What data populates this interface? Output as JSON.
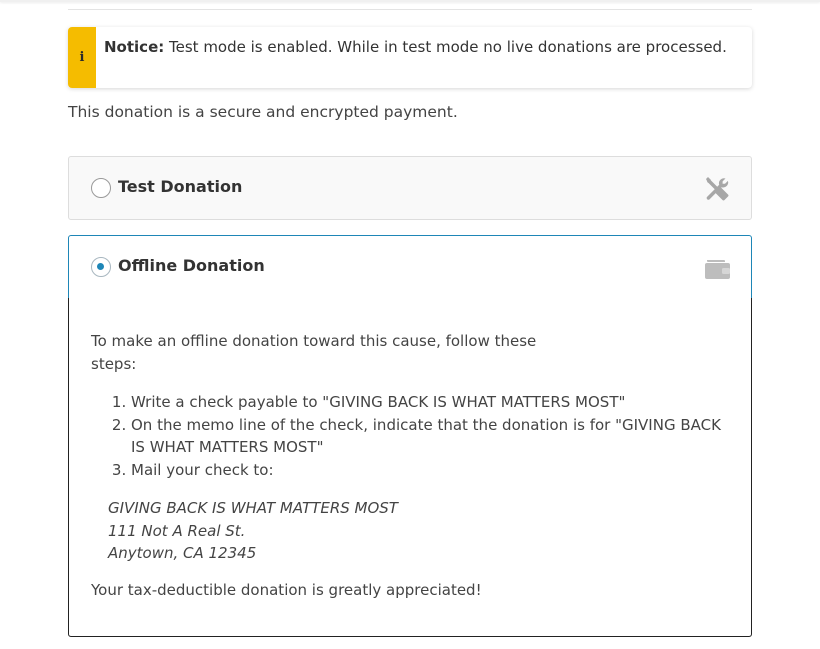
{
  "notice": {
    "icon": "info-icon",
    "icon_glyph": "i",
    "label": "Notice:",
    "message": "Test mode is enabled. While in test mode no live donations are processed.",
    "accent_color": "#f5bc00"
  },
  "secure_text": "This donation is a secure and encrypted payment.",
  "gateways": [
    {
      "label": "Test Donation",
      "selected": false,
      "icon": "tools-icon"
    },
    {
      "label": "Offline Donation",
      "selected": true,
      "icon": "wallet-icon"
    }
  ],
  "offline": {
    "intro": "To make an offline donation toward this cause, follow these steps:",
    "steps": [
      "Write a check payable to \"GIVING BACK IS WHAT MATTERS MOST\"",
      "On the memo line of the check, indicate that the donation is for \"GIVING BACK IS WHAT MATTERS MOST\"",
      "Mail your check to:"
    ],
    "address": [
      "GIVING BACK IS WHAT MATTERS MOST",
      "111 Not A Real St.",
      "Anytown, CA 12345"
    ],
    "thanks": "Your tax-deductible donation is greatly appreciated!"
  },
  "colors": {
    "selected_accent": "#1e86b7",
    "text": "#444444"
  }
}
